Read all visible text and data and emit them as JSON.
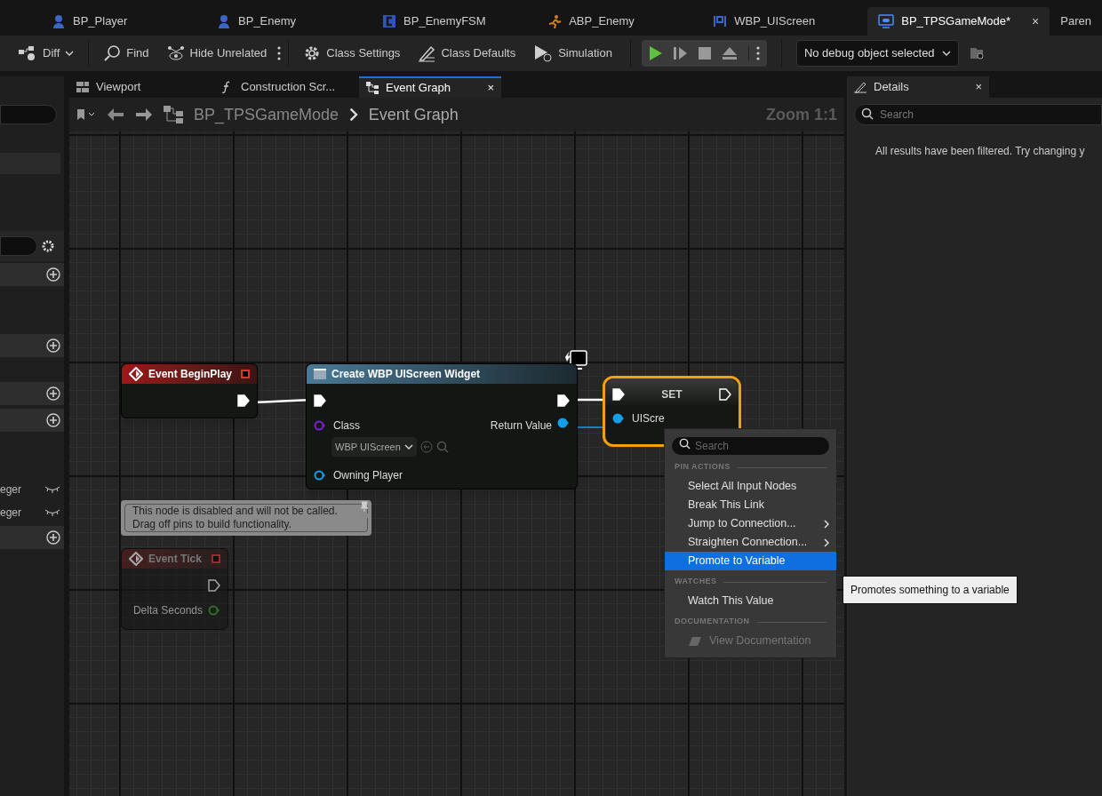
{
  "document_tabs": [
    {
      "label": "BP_Player",
      "kind": "pawn",
      "selected": false
    },
    {
      "label": "BP_Enemy",
      "kind": "pawn",
      "selected": false
    },
    {
      "label": "BP_EnemyFSM",
      "kind": "class",
      "selected": false
    },
    {
      "label": "ABP_Enemy",
      "kind": "anim",
      "selected": false
    },
    {
      "label": "WBP_UIScreen",
      "kind": "widget",
      "selected": false
    },
    {
      "label": "BP_TPSGameMode*",
      "kind": "gamemode",
      "selected": true,
      "close": "×"
    },
    {
      "label": "Paren",
      "kind": "text",
      "selected": false
    }
  ],
  "toolbar": {
    "buttons": [
      {
        "label": "Diff",
        "kind": "diff",
        "dropdown": true
      },
      {
        "label": "Find",
        "kind": "find",
        "dropdown": false
      },
      {
        "label": "Hide Unrelated",
        "kind": "hide",
        "dropdown": false
      },
      {
        "label": "Class Settings",
        "kind": "settings",
        "dropdown": false
      },
      {
        "label": "Class Defaults",
        "kind": "defaults",
        "dropdown": false
      },
      {
        "label": "Simulation",
        "kind": "simulation",
        "dropdown": false
      }
    ],
    "debug_object": "No debug object selected"
  },
  "editor_tabs": [
    {
      "label": "Viewport",
      "kind": "viewport",
      "selected": false
    },
    {
      "label": "Construction Scr...",
      "kind": "function",
      "selected": false
    },
    {
      "label": "Event Graph",
      "kind": "graph",
      "selected": true,
      "close": "×"
    }
  ],
  "breadcrumb": {
    "blueprint": "BP_TPSGameMode",
    "graph": "Event Graph"
  },
  "zoom": "Zoom 1:1",
  "left_panel": [
    {
      "kind": "search"
    },
    {
      "kind": "box"
    },
    {
      "kind": "spacer"
    },
    {
      "kind": "filter"
    },
    {
      "kind": "section"
    },
    {
      "kind": "spacer"
    },
    {
      "kind": "section"
    },
    {
      "kind": "gap"
    },
    {
      "kind": "section"
    },
    {
      "kind": "section"
    },
    {
      "kind": "spacer"
    },
    {
      "kind": "variable",
      "label": "eger"
    },
    {
      "kind": "variable",
      "label": "eger"
    },
    {
      "kind": "section"
    }
  ],
  "nodes": [
    {
      "kind": "event",
      "title": "Event BeginPlay",
      "disabled": false,
      "outputs": [
        {
          "kind": "exec"
        }
      ]
    },
    {
      "kind": "call",
      "title": "Create WBP UIScreen Widget",
      "inputs": [
        {
          "kind": "class",
          "label": "Class",
          "value": "WBP UIScreen"
        },
        {
          "kind": "object",
          "label": "Owning Player"
        }
      ],
      "outputs": [
        {
          "kind": "object",
          "label": "Return Value"
        }
      ]
    },
    {
      "kind": "set",
      "title": "SET",
      "selected": true,
      "inputs": [
        {
          "kind": "object",
          "label": "UIScre"
        }
      ]
    },
    {
      "kind": "comment",
      "text": "This node is disabled and will not be called.\nDrag off pins to build functionality."
    },
    {
      "kind": "event",
      "title": "Event Tick",
      "disabled": true,
      "outputs": [
        {
          "kind": "exec"
        },
        {
          "kind": "float",
          "label": "Delta Seconds"
        }
      ]
    }
  ],
  "details": {
    "tab": "Details",
    "close": "×",
    "search_placeholder": "Search",
    "message": "All results have been filtered. Try changing y"
  },
  "context_menu": {
    "search_placeholder": "Search",
    "sections": [
      {
        "title": "PIN ACTIONS",
        "items": [
          {
            "label": "Select All Input Nodes",
            "submenu": false,
            "selected": false,
            "disabled": false
          },
          {
            "label": "Break This Link",
            "submenu": false,
            "selected": false,
            "disabled": false
          },
          {
            "label": "Jump to Connection...",
            "submenu": true,
            "selected": false,
            "disabled": false
          },
          {
            "label": "Straighten Connection...",
            "submenu": true,
            "selected": false,
            "disabled": false
          },
          {
            "label": "Promote to Variable",
            "submenu": false,
            "selected": true,
            "disabled": false
          }
        ]
      },
      {
        "title": "WATCHES",
        "items": [
          {
            "label": "Watch This Value",
            "submenu": false,
            "selected": false,
            "disabled": false
          }
        ]
      },
      {
        "title": "DOCUMENTATION",
        "items": [
          {
            "label": "View Documentation",
            "submenu": false,
            "selected": false,
            "disabled": true
          }
        ]
      }
    ]
  },
  "tooltip": "Promotes something to a variable"
}
